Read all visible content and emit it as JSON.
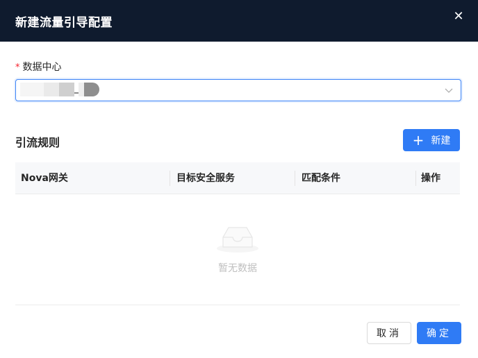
{
  "dialog": {
    "title": "新建流量引导配置",
    "close_icon": "close-icon"
  },
  "form": {
    "datacenter_label": "数据中心",
    "required_mark": "*",
    "select_arrow_icon": "chevron-down-icon"
  },
  "rules": {
    "section_title": "引流规则",
    "new_button_label": "新建",
    "new_button_icon": "plus-icon"
  },
  "table": {
    "columns": [
      "Nova网关",
      "目标安全服务",
      "匹配条件",
      "操作"
    ],
    "rows": [],
    "empty_text": "暂无数据",
    "empty_icon": "inbox-icon"
  },
  "footer": {
    "cancel_label": "取消",
    "confirm_label": "确定"
  },
  "colors": {
    "header_bg": "#0f1b2e",
    "primary": "#2f7bf5",
    "required": "#f5222d"
  }
}
